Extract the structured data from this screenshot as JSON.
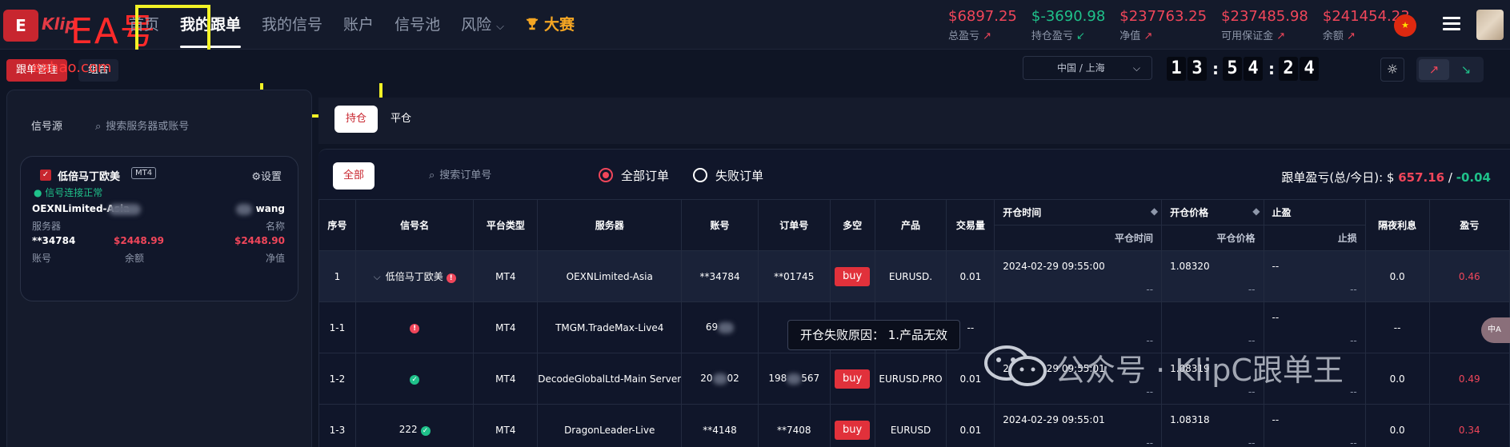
{
  "logo": {
    "badge": "E",
    "word": "Klip",
    "ea_text": "EA号",
    "domain": "eahao.com"
  },
  "nav": [
    {
      "label": "首页"
    },
    {
      "label": "我的跟单"
    },
    {
      "label": "我的信号"
    },
    {
      "label": "账户"
    },
    {
      "label": "信号池"
    },
    {
      "label": "风险"
    },
    {
      "label": "大赛"
    }
  ],
  "stats": [
    {
      "value": "$6897.25",
      "label": "总盈亏",
      "arrow": "↗",
      "color": "red"
    },
    {
      "value": "$-3690.98",
      "label": "持仓盈亏",
      "arrow": "↙",
      "color": "green"
    },
    {
      "value": "$237763.25",
      "label": "净值",
      "arrow": "↗",
      "color": "red"
    },
    {
      "value": "$237485.98",
      "label": "可用保证金",
      "arrow": "↗",
      "color": "red"
    },
    {
      "value": "$241454.23",
      "label": "余额",
      "arrow": "↗",
      "color": "red"
    }
  ],
  "subtabs": {
    "manage": "跟单管理",
    "combo": "组合"
  },
  "timezone": "中国 / 上海",
  "clock": [
    "1",
    "3",
    "5",
    "4",
    "2",
    "4"
  ],
  "left": {
    "title": "信号源",
    "search_placeholder": "搜索服务器或账号",
    "card": {
      "name": "低倍马丁欧美",
      "platform": "MT4",
      "settings": "设置",
      "status": "信号连接正常",
      "server": "OEXNLimited-Asia",
      "server_label": "服务器",
      "user": "wang",
      "user_label": "名称",
      "account": "**34784",
      "account_label": "账号",
      "balance": "$2448.99",
      "balance_label": "余额",
      "equity": "$2448.90",
      "equity_label": "净值"
    }
  },
  "position_tabs": {
    "open": "持仓",
    "closed": "平仓"
  },
  "filters": {
    "all": "全部",
    "order_search_placeholder": "搜索订单号",
    "all_orders": "全部订单",
    "failed_orders": "失败订单",
    "summary_label": "跟单盈亏(总/今日):",
    "summary_currency": "$",
    "summary_total": "657.16",
    "summary_sep": "/",
    "summary_today": "-0.04"
  },
  "table": {
    "headers": [
      "序号",
      "信号名",
      "平台类型",
      "服务器",
      "账号",
      "订单号",
      "多空",
      "产品",
      "交易量",
      "开仓时间",
      "开仓价格",
      "止盈",
      "隔夜利息",
      "盈亏"
    ],
    "subheaders": {
      "close_time": "平仓时间",
      "close_price": "平仓价格",
      "stop_loss": "止损"
    },
    "rows": [
      {
        "no": "1",
        "signal": "低倍马丁欧美",
        "platform": "MT4",
        "server": "OEXNLimited-Asia",
        "account": "**34784",
        "order": "**01745",
        "side": "buy",
        "product": "EURUSD.",
        "volume": "0.01",
        "open_time": "2024-02-29 09:55:00",
        "close_time": "--",
        "open_price": "1.08320",
        "close_price": "--",
        "tp": "--",
        "sl": "--",
        "swap": "0.0",
        "profit": "0.46"
      },
      {
        "no": "1-1",
        "signal": "",
        "platform": "MT4",
        "server": "TMGM.TradeMax-Live4",
        "account": "69",
        "order": "",
        "side": "",
        "product": "",
        "volume": "--",
        "open_time": "",
        "close_time": "--",
        "open_price": "",
        "close_price": "--",
        "tp": "--",
        "sl": "--",
        "swap": "--",
        "profit": ""
      },
      {
        "no": "1-2",
        "signal": "",
        "platform": "MT4",
        "server": "DecodeGlobalLtd-Main Server",
        "account": "20",
        "account_end": "02",
        "order": "198",
        "order_end": "567",
        "side": "buy",
        "product": "EURUSD.PRO",
        "volume": "0.01",
        "open_time": "2024-02-29 09:55:01",
        "close_time": "--",
        "open_price": "1.08319",
        "close_price": "--",
        "tp": "--",
        "sl": "--",
        "swap": "0.0",
        "profit": "0.49"
      },
      {
        "no": "1-3",
        "signal": "222",
        "platform": "MT4",
        "server": "DragonLeader-Live",
        "account": "**4148",
        "order": "**7408",
        "side": "buy",
        "product": "EURUSD",
        "volume": "0.01",
        "open_time": "2024-02-29 09:55:01",
        "close_time": "--",
        "open_price": "1.08318",
        "close_price": "--",
        "tp": "--",
        "sl": "--",
        "swap": "0.0",
        "profit": "0.34"
      }
    ]
  },
  "tooltip": "开仓失败原因： 1.产品无效",
  "watermark": "公众号 · KlipC跟单王",
  "side_widget": "中A"
}
